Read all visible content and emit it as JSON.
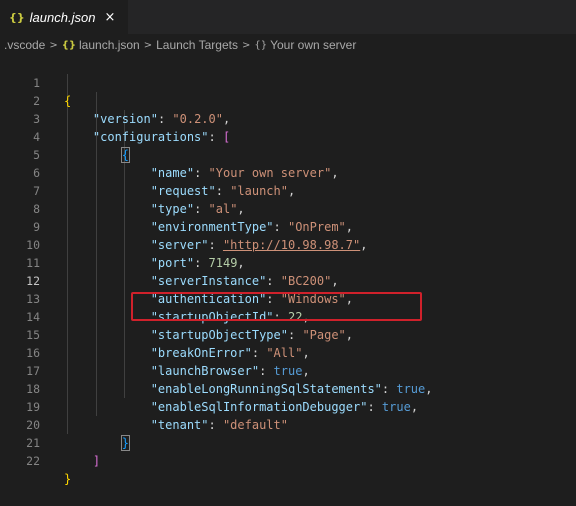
{
  "tab": {
    "icon": "{}",
    "label": "launch.json",
    "close": "×"
  },
  "breadcrumb": {
    "items": [
      ".vscode",
      "launch.json",
      "Launch Targets",
      "Your own server"
    ],
    "separator": ">",
    "json_icon": "{}",
    "object_icon": "{}"
  },
  "editor": {
    "line_numbers": [
      "1",
      "2",
      "3",
      "4",
      "5",
      "6",
      "7",
      "8",
      "9",
      "10",
      "11",
      "12",
      "13",
      "14",
      "15",
      "16",
      "17",
      "18",
      "19",
      "20",
      "21",
      "22"
    ],
    "active_line": "12",
    "lines": {
      "l1_open": "{",
      "l2_key": "\"version\"",
      "l2_val": "\"0.2.0\"",
      "l3_key": "\"configurations\"",
      "l3_open": "[",
      "l4_open": "{",
      "l5_key": "\"name\"",
      "l5_val": "\"Your own server\"",
      "l6_key": "\"request\"",
      "l6_val": "\"launch\"",
      "l7_key": "\"type\"",
      "l7_val": "\"al\"",
      "l8_key": "\"environmentType\"",
      "l8_val": "\"OnPrem\"",
      "l9_key": "\"server\"",
      "l9_val": "\"http://10.98.98.7\"",
      "l10_key": "\"port\"",
      "l10_val": "7149",
      "l11_key": "\"serverInstance\"",
      "l11_val": "\"BC200\"",
      "l12_key": "\"authentication\"",
      "l12_val": "\"Windows\"",
      "l13_key": "\"startupObjectId\"",
      "l13_val": "22",
      "l14_key": "\"startupObjectType\"",
      "l14_val": "\"Page\"",
      "l15_key": "\"breakOnError\"",
      "l15_val": "\"All\"",
      "l16_key": "\"launchBrowser\"",
      "l16_val": "true",
      "l17_key": "\"enableLongRunningSqlStatements\"",
      "l17_val": "true",
      "l18_key": "\"enableSqlInformationDebugger\"",
      "l18_val": "true",
      "l19_key": "\"tenant\"",
      "l19_val": "\"default\"",
      "l20_close": "}",
      "l21_close": "]",
      "l22_close": "}"
    }
  },
  "colors": {
    "background": "#1e1e1e",
    "key": "#9cdcfe",
    "string": "#ce9178",
    "number": "#b5cea8",
    "keyword": "#569cd6",
    "highlight_box": "#d0212b"
  }
}
